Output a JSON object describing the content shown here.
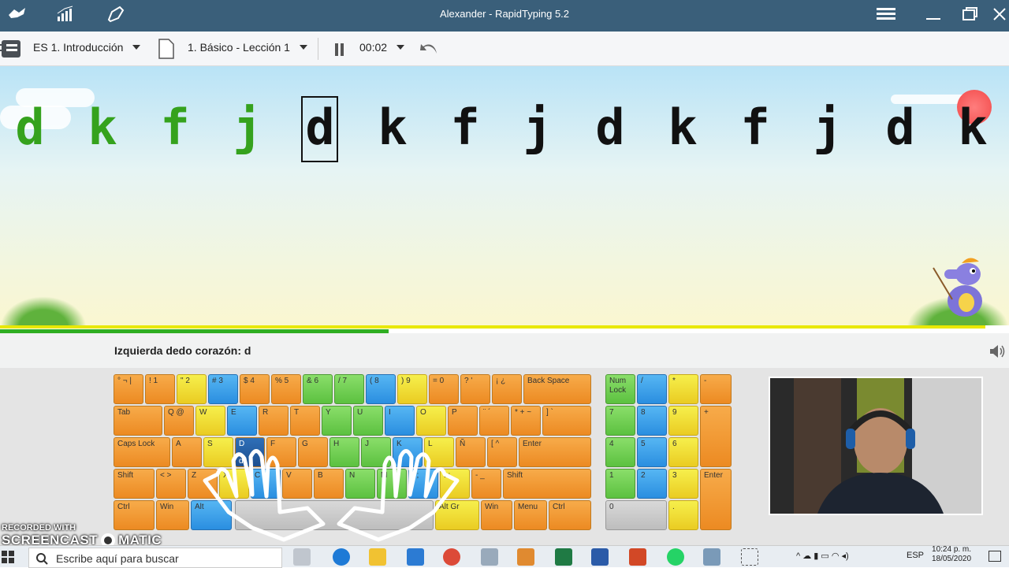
{
  "window": {
    "title": "Alexander - RapidTyping 5.2"
  },
  "toolbar": {
    "course": "ES 1. Introducción",
    "lesson": "1. Básico - Lección 1",
    "timer": "00:02"
  },
  "exercise": {
    "characters": [
      "d",
      "k",
      "f",
      "j",
      "d",
      "k",
      "f",
      "j",
      "d",
      "k",
      "f",
      "j",
      "d",
      "k"
    ],
    "typed_count": 4,
    "current_index": 4,
    "progress": 0.385
  },
  "hint": {
    "text": "Izquierda dedo corazón: d"
  },
  "keyboard": {
    "rows": [
      [
        "° ¬ |",
        "! 1",
        "\" 2",
        "# 3",
        "$ 4",
        "% 5",
        "& 6",
        "/ 7",
        "( 8",
        ") 9",
        "= 0",
        "? '",
        "¡ ¿",
        "Back Space"
      ],
      [
        "Tab",
        "Q @",
        "W",
        "E",
        "R",
        "T",
        "Y",
        "U",
        "I",
        "O",
        "P",
        "¨ ´",
        "* + ~",
        "] `"
      ],
      [
        "Caps Lock",
        "A",
        "S",
        "D",
        "F",
        "G",
        "H",
        "J",
        "K",
        "L",
        "Ñ",
        "[ ^",
        "Enter"
      ],
      [
        "Shift",
        "< >",
        "Z",
        "X",
        "C",
        "V",
        "B",
        "N",
        "M",
        ", ;",
        ". :",
        "- _",
        "Shift"
      ],
      [
        "Ctrl",
        "Win",
        "Alt",
        "",
        "Alt Gr",
        "Win",
        "Menu",
        "Ctrl"
      ]
    ],
    "active_key_label": "d",
    "numpad": [
      "Num Lock",
      "/",
      "*",
      "-",
      "7",
      "8",
      "9",
      "+",
      "4",
      "5",
      "6",
      "1",
      "2",
      "3",
      "Enter",
      "0",
      "."
    ]
  },
  "watermark": {
    "line1": "RECORDED WITH",
    "line2": "SCREENCAST",
    "line3": "MATIC"
  },
  "taskbar": {
    "search_placeholder": "Escribe aquí para buscar",
    "lang": "ESP",
    "time": "10:24 p. m.",
    "date": "18/05/2020"
  },
  "colors": {
    "titlebar": "#3a5f7a",
    "typed": "#35a21d",
    "progress": "#2fae22"
  }
}
